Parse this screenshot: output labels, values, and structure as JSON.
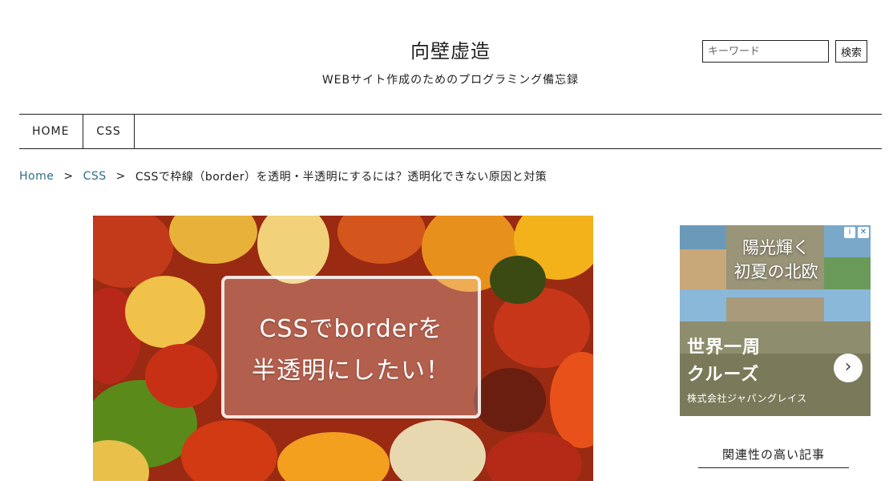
{
  "site": {
    "title": "向壁虚造",
    "tagline": "WEBサイト作成のためのプログラミング備忘録"
  },
  "search": {
    "placeholder": "キーワード",
    "button_label": "検索"
  },
  "nav": {
    "items": [
      {
        "label": "HOME"
      },
      {
        "label": "CSS"
      }
    ]
  },
  "breadcrumb": {
    "home": "Home",
    "separator": ">",
    "category": "CSS",
    "current": "CSSで枠線（border）を透明・半透明にするには？透明化できない原因と対策"
  },
  "eyecatch": {
    "line1": "CSSでborderを",
    "line2": "半透明にしたい！"
  },
  "ad": {
    "headline_line1": "陽光輝く",
    "headline_line2": "初夏の北欧",
    "title_line1": "世界一周",
    "title_line2": "クルーズ",
    "sponsor": "株式会社ジャパングレイス",
    "arrow": "›",
    "info_icon": "i",
    "close_icon": "✕"
  },
  "sidebar": {
    "related_heading": "関連性の高い記事"
  },
  "colors": {
    "link": "#2f6d82",
    "text": "#222222"
  }
}
